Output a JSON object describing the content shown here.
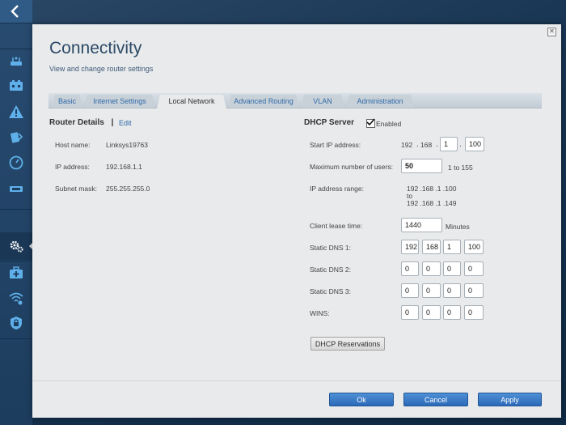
{
  "header": {
    "title": "Connectivity",
    "subtitle": "View and change router settings",
    "close": "✕"
  },
  "tabs": [
    {
      "label": "Basic",
      "active": false
    },
    {
      "label": "Internet Settings",
      "active": false
    },
    {
      "label": "Local Network",
      "active": true
    },
    {
      "label": "Advanced Routing",
      "active": false
    },
    {
      "label": "VLAN",
      "active": false
    },
    {
      "label": "Administration",
      "active": false
    }
  ],
  "router_details": {
    "heading": "Router Details",
    "separator": "|",
    "edit_label": "Edit",
    "host_name_label": "Host name:",
    "host_name_value": "Linksys19763",
    "ip_label": "IP address:",
    "ip_value": "192.168.1.1",
    "subnet_label": "Subnet mask:",
    "subnet_value": "255.255.255.0"
  },
  "dhcp": {
    "heading": "DHCP Server",
    "enabled_label": "Enabled",
    "enabled": true,
    "start_ip_label": "Start IP address:",
    "start_ip_fixed_1": "192",
    "start_ip_fixed_2": "168",
    "start_ip_octet3": "1",
    "start_ip_octet4": "100",
    "max_users_label": "Maximum number of users:",
    "max_users_value": "50",
    "max_users_range": "1 to 155",
    "range_label": "IP address range:",
    "range_from": "192 .168 .1 .100",
    "range_to_word": "to",
    "range_to": "192 .168 .1 .149",
    "lease_label": "Client lease time:",
    "lease_value": "1440",
    "lease_unit": "Minutes",
    "dns1_label": "Static DNS 1:",
    "dns1": [
      "192",
      "168",
      "1",
      "100"
    ],
    "dns2_label": "Static DNS 2:",
    "dns2": [
      "0",
      "0",
      "0",
      "0"
    ],
    "dns3_label": "Static DNS 3:",
    "dns3": [
      "0",
      "0",
      "0",
      "0"
    ],
    "wins_label": "WINS:",
    "wins": [
      "0",
      "0",
      "0",
      "0"
    ],
    "reservations_label": "DHCP Reservations"
  },
  "footer": {
    "ok_label": "Ok",
    "cancel_label": "Cancel",
    "apply_label": "Apply"
  },
  "colors": {
    "accent_blue": "#2a6ab8",
    "title_color": "#2d4a66",
    "link_color": "#2f6aa8"
  },
  "nav_icons": [
    "back-chevron-icon",
    "router-icon",
    "devices-icon",
    "warning-icon",
    "external-storage-icon",
    "speed-test-icon",
    "usb-icon",
    "settings-gear-icon",
    "medical-kit-icon",
    "wifi-icon",
    "security-lock-icon"
  ]
}
